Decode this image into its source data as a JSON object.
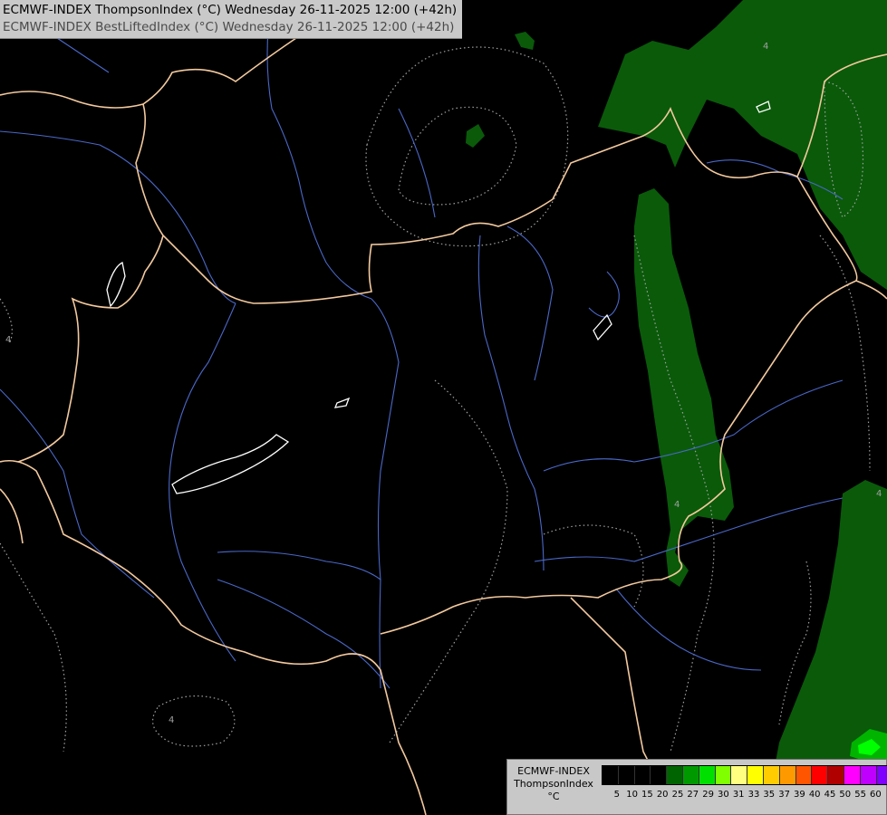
{
  "header": {
    "title_primary": "ECMWF-INDEX ThompsonIndex (°C) Wednesday 26-11-2025 12:00 (+42h)",
    "title_secondary": "ECMWF-INDEX BestLiftedIndex (°C) Wednesday 26-11-2025 12:00 (+42h)"
  },
  "legend": {
    "line1": "ECMWF-INDEX",
    "line2": "ThompsonIndex",
    "unit": "°C",
    "ticks": [
      "5",
      "10",
      "15",
      "20",
      "25",
      "27",
      "29",
      "30",
      "31",
      "33",
      "35",
      "37",
      "39",
      "40",
      "45",
      "50",
      "55",
      "60"
    ],
    "colors": [
      "#000000",
      "#000000",
      "#000000",
      "#000000",
      "#006400",
      "#009a00",
      "#00e000",
      "#80ff00",
      "#ffff80",
      "#ffff00",
      "#ffcc00",
      "#ff9900",
      "#ff5500",
      "#ff0000",
      "#b00000",
      "#ff00ff",
      "#c000ff",
      "#8000ff",
      "#0000ff"
    ]
  },
  "map": {
    "contour_labels": [
      "4",
      "4",
      "4",
      "4",
      "4"
    ],
    "colors": {
      "background": "#000000",
      "border": "#f3c99e",
      "river": "#4a68c8",
      "dotted_contour": "#a0a0a0",
      "fill_dark_green": "#0a5a0a",
      "fill_green": "#00b400",
      "fill_bright": "#00ff00",
      "lake": "#ffffff"
    }
  }
}
